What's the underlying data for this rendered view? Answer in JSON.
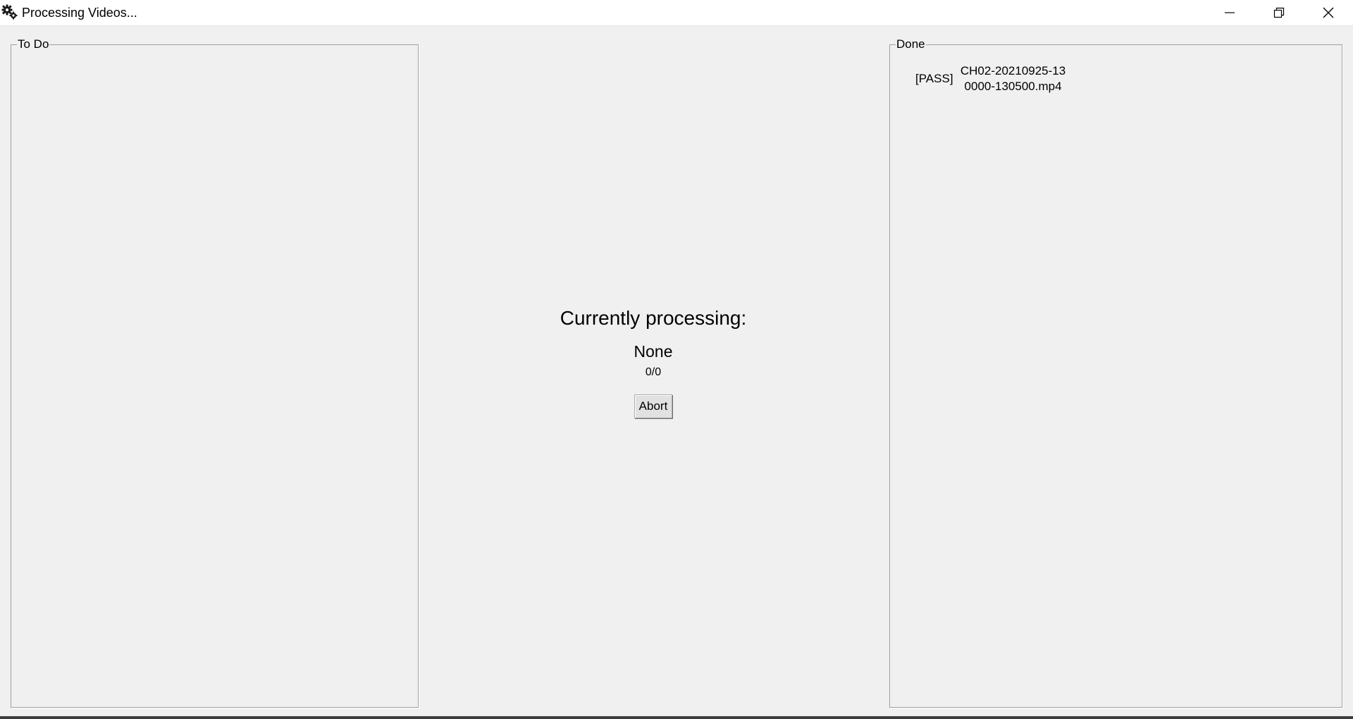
{
  "window": {
    "title": "Processing Videos...",
    "icon": "gears-icon",
    "controls": [
      "minimize-icon",
      "restore-icon",
      "close-icon"
    ]
  },
  "todo": {
    "label": "To Do",
    "items": []
  },
  "done": {
    "label": "Done",
    "items": [
      {
        "status": "[PASS]",
        "file": "CH02-20210925-130000-130500.mp4"
      }
    ]
  },
  "processing": {
    "heading": "Currently processing:",
    "current": "None",
    "progress": "0/0",
    "abort_label": "Abort"
  }
}
